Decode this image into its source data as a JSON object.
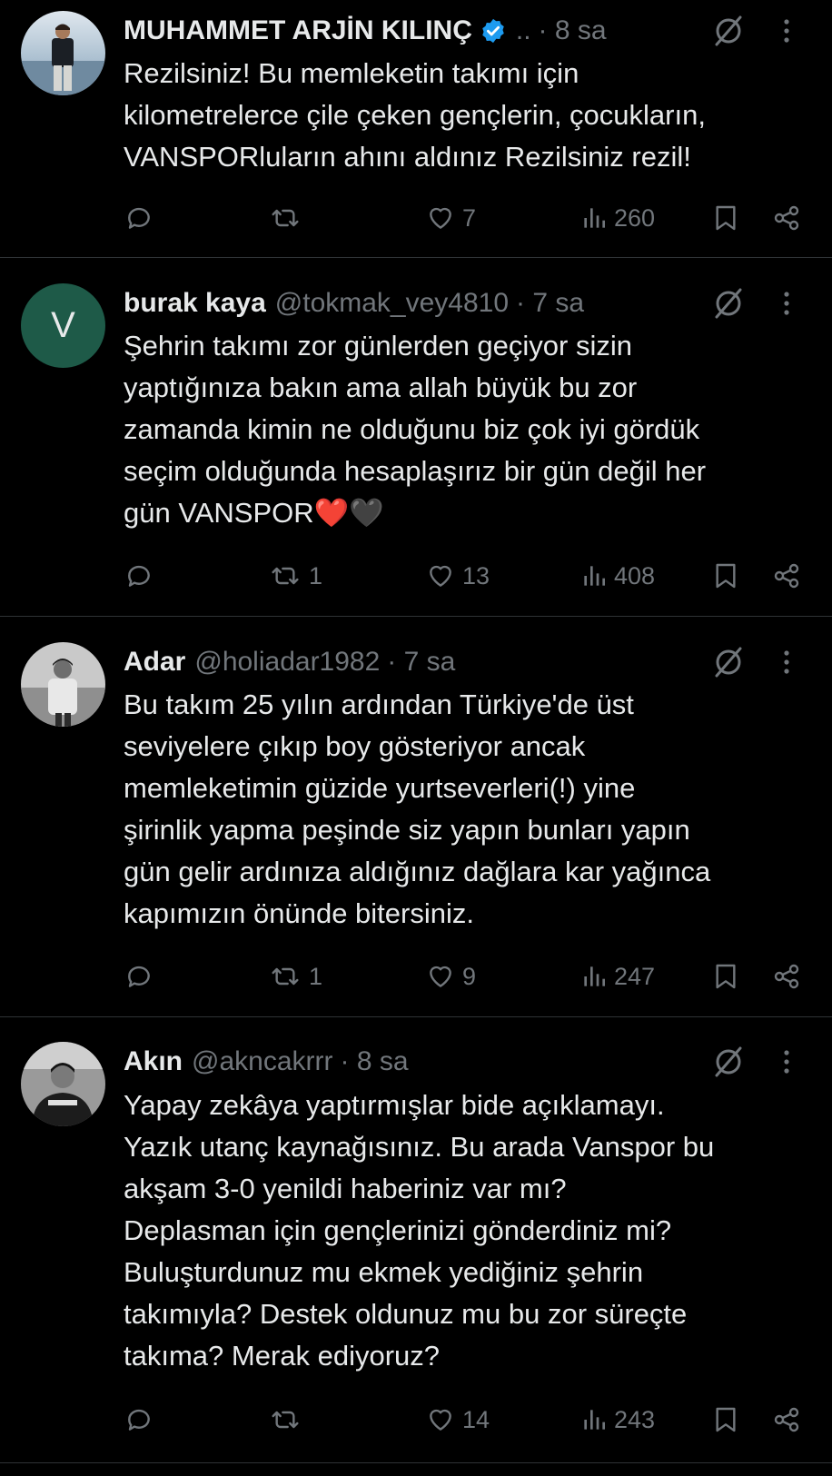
{
  "colors": {
    "background": "#000000",
    "text": "#e7e9ea",
    "muted": "#71767b",
    "divider": "#2f3336",
    "verified": "#1d9bf0",
    "avatar_v": "#1e5a48"
  },
  "replies": [
    {
      "name": "MUHAMMET ARJİN KILINÇ",
      "verified": true,
      "handle": "..",
      "time": "· 8 sa",
      "avatar_letter": "",
      "text": "Rezilsiniz! Bu memleketin takımı için\nkilometrelerce çile çeken gençlerin, çocukların,\nVANSPORluların ahını aldınız Rezilsiniz rezil!",
      "reposts": "",
      "likes": "7",
      "views": "260"
    },
    {
      "name": "burak kaya",
      "verified": false,
      "handle": "@tokmak_vey4810",
      "time": "· 7 sa",
      "avatar_letter": "V",
      "text": "Şehrin takımı zor günlerden geçiyor sizin\nyaptığınıza bakın ama allah büyük bu zor\nzamanda kimin ne olduğunu biz çok iyi gördük\nseçim olduğunda hesaplaşırız bir gün değil her\ngün VANSPOR❤️🖤",
      "reposts": "1",
      "likes": "13",
      "views": "408"
    },
    {
      "name": "Adar",
      "verified": false,
      "handle": "@holiadar1982",
      "time": "· 7 sa",
      "avatar_letter": "",
      "text": "Bu takım 25 yılın ardından Türkiye'de üst\nseviyelere çıkıp boy gösteriyor ancak\nmemleketimin güzide yurtseverleri(!) yine\nşirinlik yapma peşinde siz yapın bunları yapın\ngün gelir ardınıza aldığınız dağlara kar yağınca\nkapımızın önünde bitersiniz.",
      "reposts": "1",
      "likes": "9",
      "views": "247"
    },
    {
      "name": "Akın",
      "verified": false,
      "handle": "@akncakrrr",
      "time": "· 8 sa",
      "avatar_letter": "",
      "text": "Yapay zekâya yaptırmışlar bide açıklamayı.\nYazık utanç kaynağısınız. Bu arada Vanspor bu\nakşam 3-0 yenildi haberiniz var mı?\nDeplasman için gençlerinizi gönderdiniz mi?\nBuluşturdunuz mu ekmek yediğiniz şehrin\ntakımıyla? Destek oldunuz mu bu zor süreçte\ntakıma? Merak ediyoruz?",
      "reposts": "",
      "likes": "14",
      "views": "243"
    }
  ]
}
